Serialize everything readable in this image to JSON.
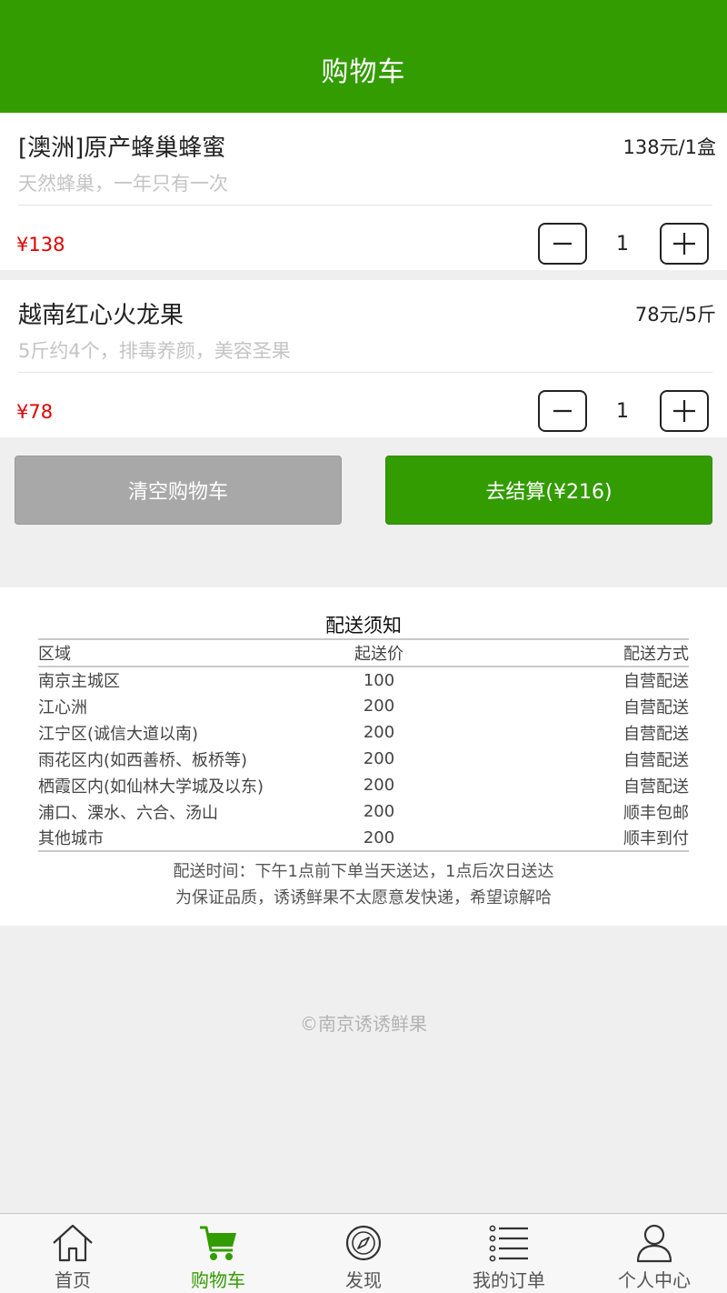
{
  "header": {
    "title": "购物车"
  },
  "cart": {
    "items": [
      {
        "name": "[澳洲]原产蜂巢蜂蜜",
        "unit_price": "138元/1盒",
        "description": "天然蜂巢，一年只有一次",
        "price": "¥138",
        "quantity": "1"
      },
      {
        "name": "越南红心火龙果",
        "unit_price": "78元/5斤",
        "description": "5斤约4个，排毒养颜，美容圣果",
        "price": "¥78",
        "quantity": "1"
      }
    ]
  },
  "actions": {
    "clear_label": "清空购物车",
    "checkout_label": "去结算(¥216)"
  },
  "delivery": {
    "title": "配送须知",
    "headers": [
      "区域",
      "起送价",
      "配送方式"
    ],
    "rows": [
      [
        "南京主城区",
        "100",
        "自营配送"
      ],
      [
        "江心洲",
        "200",
        "自营配送"
      ],
      [
        "江宁区(诚信大道以南)",
        "200",
        "自营配送"
      ],
      [
        "雨花区内(如西善桥、板桥等)",
        "200",
        "自营配送"
      ],
      [
        "栖霞区内(如仙林大学城及以东)",
        "200",
        "自营配送"
      ],
      [
        "浦口、溧水、六合、汤山",
        "200",
        "顺丰包邮"
      ],
      [
        "其他城市",
        "200",
        "顺丰到付"
      ]
    ],
    "note_time": "配送时间：下午1点前下单当天送达，1点后次日送达",
    "note_quality": "为保证品质，诱诱鲜果不太愿意发快递，希望谅解哈"
  },
  "footer": {
    "copyright": "©南京诱诱鲜果"
  },
  "tabbar": {
    "tabs": [
      {
        "label": "首页",
        "icon": "home-icon"
      },
      {
        "label": "购物车",
        "icon": "cart-icon",
        "active": true
      },
      {
        "label": "发现",
        "icon": "compass-icon"
      },
      {
        "label": "我的订单",
        "icon": "list-icon"
      },
      {
        "label": "个人中心",
        "icon": "user-icon"
      }
    ]
  },
  "colors": {
    "brand": "#339c00",
    "price": "#e00000",
    "clear_button": "#a8a8a8"
  }
}
